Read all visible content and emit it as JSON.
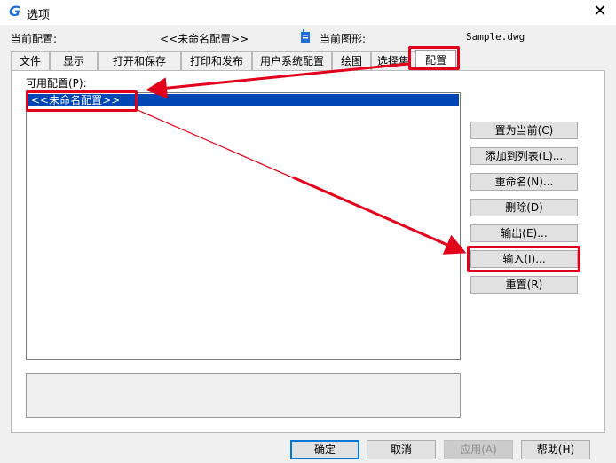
{
  "window": {
    "title": "选项",
    "logo_glyph": "G",
    "close_glyph": "✕"
  },
  "info": {
    "current_profile_label": "当前配置:",
    "current_profile_value": "<<未命名配置>>",
    "current_drawing_label": "当前图形:",
    "current_drawing_value": "Sample.dwg"
  },
  "tabs": [
    "文件",
    "显示",
    "打开和保存",
    "打印和发布",
    "用户系统配置",
    "绘图",
    "选择集",
    "配置"
  ],
  "profiles": {
    "label": "可用配置(P):",
    "items": [
      "<<未命名配置>>"
    ]
  },
  "side_buttons": {
    "set_current": "置为当前(C)",
    "add_to_list": "添加到列表(L)...",
    "rename": "重命名(N)...",
    "delete": "删除(D)",
    "export": "输出(E)...",
    "import": "输入(I)...",
    "reset": "重置(R)"
  },
  "bottom_buttons": {
    "ok": "确定",
    "cancel": "取消",
    "apply": "应用(A)",
    "help": "帮助(H)"
  },
  "colors": {
    "accent": "#0046b4",
    "highlight": "#e3001b",
    "logo": "#1e6fd8"
  }
}
